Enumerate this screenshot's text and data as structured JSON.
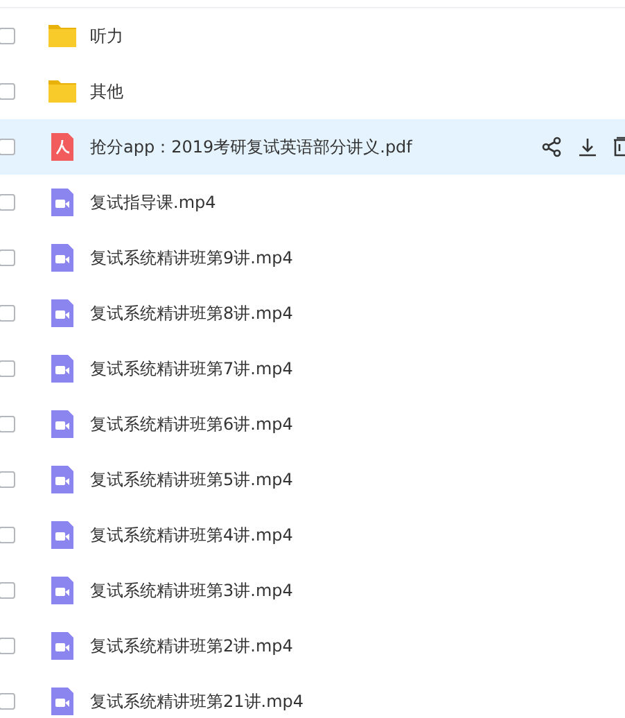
{
  "files": [
    {
      "kind": "folder",
      "name": "听力",
      "checked": false,
      "highlighted": false
    },
    {
      "kind": "folder",
      "name": "其他",
      "checked": false,
      "highlighted": false
    },
    {
      "kind": "pdf",
      "name": "抢分app：2019考研复试英语部分讲义.pdf",
      "checked": false,
      "highlighted": true
    },
    {
      "kind": "video",
      "name": "复试指导课.mp4",
      "checked": false,
      "highlighted": false
    },
    {
      "kind": "video",
      "name": "复试系统精讲班第9讲.mp4",
      "checked": false,
      "highlighted": false
    },
    {
      "kind": "video",
      "name": "复试系统精讲班第8讲.mp4",
      "checked": false,
      "highlighted": false
    },
    {
      "kind": "video",
      "name": "复试系统精讲班第7讲.mp4",
      "checked": false,
      "highlighted": false
    },
    {
      "kind": "video",
      "name": "复试系统精讲班第6讲.mp4",
      "checked": false,
      "highlighted": false
    },
    {
      "kind": "video",
      "name": "复试系统精讲班第5讲.mp4",
      "checked": false,
      "highlighted": false
    },
    {
      "kind": "video",
      "name": "复试系统精讲班第4讲.mp4",
      "checked": false,
      "highlighted": false
    },
    {
      "kind": "video",
      "name": "复试系统精讲班第3讲.mp4",
      "checked": false,
      "highlighted": false
    },
    {
      "kind": "video",
      "name": "复试系统精讲班第2讲.mp4",
      "checked": false,
      "highlighted": false
    },
    {
      "kind": "video",
      "name": "复试系统精讲班第21讲.mp4",
      "checked": false,
      "highlighted": false
    }
  ]
}
